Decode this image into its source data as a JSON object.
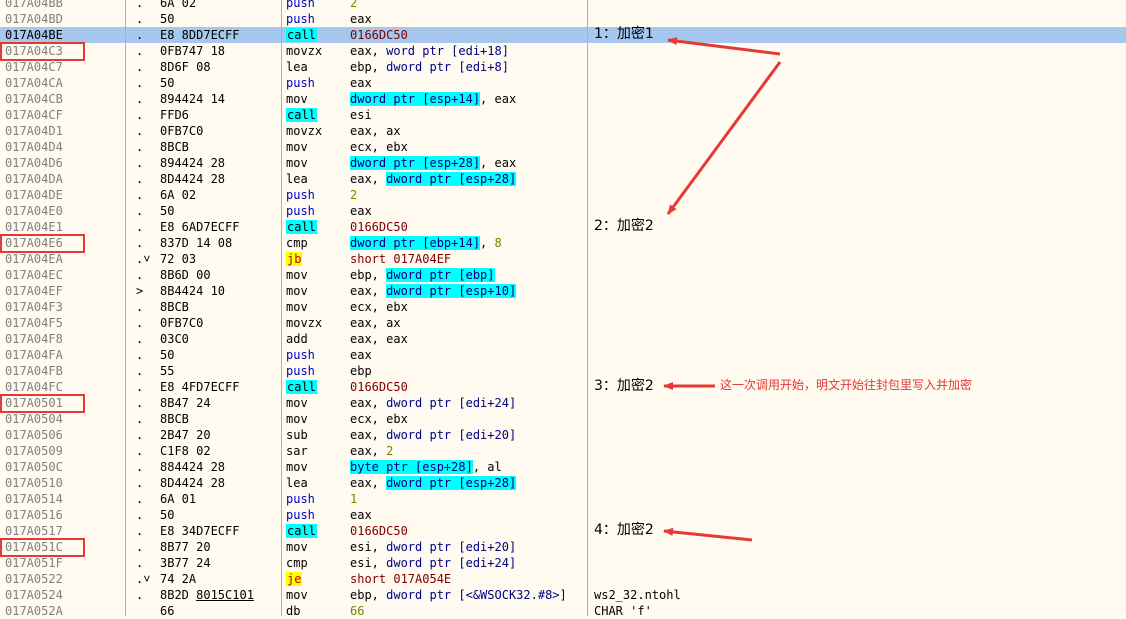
{
  "rows": [
    {
      "addr": "017A04BB",
      "mark": ".",
      "bytes": "6A 02",
      "mn": "push",
      "mk": "push",
      "ops": [
        {
          "t": "2",
          "k": "num"
        }
      ],
      "cmt": ""
    },
    {
      "addr": "017A04BD",
      "mark": ".",
      "bytes": "50",
      "mn": "push",
      "mk": "push",
      "ops": [
        {
          "t": "eax"
        }
      ],
      "cmt": ""
    },
    {
      "addr": "017A04BE",
      "mark": ".",
      "bytes": "E8 8DD7ECFF",
      "mn": "call",
      "mk": "call",
      "ops": [
        {
          "t": "0166DC50",
          "k": "tcall"
        }
      ],
      "cmt": "1：加密1",
      "selected": true
    },
    {
      "addr": "017A04C3",
      "mark": ".",
      "bytes": "0FB747 18",
      "mn": "movzx",
      "ops": [
        {
          "t": "eax, "
        },
        {
          "t": "word ptr [edi+18]",
          "k": "mem"
        }
      ],
      "cmt": "",
      "boxed": true
    },
    {
      "addr": "017A04C7",
      "mark": ".",
      "bytes": "8D6F 08",
      "mn": "lea",
      "ops": [
        {
          "t": "ebp, "
        },
        {
          "t": "dword ptr [edi+8]",
          "k": "mem"
        }
      ],
      "cmt": ""
    },
    {
      "addr": "017A04CA",
      "mark": ".",
      "bytes": "50",
      "mn": "push",
      "mk": "push",
      "ops": [
        {
          "t": "eax"
        }
      ],
      "cmt": ""
    },
    {
      "addr": "017A04CB",
      "mark": ".",
      "bytes": "894424 14",
      "mn": "mov",
      "ops": [
        {
          "t": "dword ptr [esp+14]",
          "k": "hlmem"
        },
        {
          "t": ", eax"
        }
      ],
      "cmt": ""
    },
    {
      "addr": "017A04CF",
      "mark": ".",
      "bytes": "FFD6",
      "mn": "call",
      "mk": "call",
      "ops": [
        {
          "t": "esi"
        }
      ],
      "cmt": ""
    },
    {
      "addr": "017A04D1",
      "mark": ".",
      "bytes": "0FB7C0",
      "mn": "movzx",
      "ops": [
        {
          "t": "eax, ax"
        }
      ],
      "cmt": ""
    },
    {
      "addr": "017A04D4",
      "mark": ".",
      "bytes": "8BCB",
      "mn": "mov",
      "ops": [
        {
          "t": "ecx, ebx"
        }
      ],
      "cmt": ""
    },
    {
      "addr": "017A04D6",
      "mark": ".",
      "bytes": "894424 28",
      "mn": "mov",
      "ops": [
        {
          "t": "dword ptr [esp+28]",
          "k": "hlmem"
        },
        {
          "t": ", eax"
        }
      ],
      "cmt": ""
    },
    {
      "addr": "017A04DA",
      "mark": ".",
      "bytes": "8D4424 28",
      "mn": "lea",
      "ops": [
        {
          "t": "eax, "
        },
        {
          "t": "dword ptr [esp+28]",
          "k": "hlmem"
        }
      ],
      "cmt": ""
    },
    {
      "addr": "017A04DE",
      "mark": ".",
      "bytes": "6A 02",
      "mn": "push",
      "mk": "push",
      "ops": [
        {
          "t": "2",
          "k": "num"
        }
      ],
      "cmt": ""
    },
    {
      "addr": "017A04E0",
      "mark": ".",
      "bytes": "50",
      "mn": "push",
      "mk": "push",
      "ops": [
        {
          "t": "eax"
        }
      ],
      "cmt": ""
    },
    {
      "addr": "017A04E1",
      "mark": ".",
      "bytes": "E8 6AD7ECFF",
      "mn": "call",
      "mk": "call",
      "ops": [
        {
          "t": "0166DC50",
          "k": "tcall"
        }
      ],
      "cmt": "2：加密2"
    },
    {
      "addr": "017A04E6",
      "mark": ".",
      "bytes": "837D 14 08",
      "mn": "cmp",
      "ops": [
        {
          "t": "dword ptr [ebp+14]",
          "k": "hlmem"
        },
        {
          "t": ", "
        },
        {
          "t": "8",
          "k": "num"
        }
      ],
      "cmt": "",
      "boxed": true
    },
    {
      "addr": "017A04EA",
      "mark": ".˅",
      "bytes": "72 03",
      "mn": "jb",
      "mk": "jmp",
      "ops": [
        {
          "t": "short 017A04EF",
          "k": "tjmp"
        }
      ],
      "cmt": ""
    },
    {
      "addr": "017A04EC",
      "mark": ".",
      "bytes": "8B6D 00",
      "mn": "mov",
      "ops": [
        {
          "t": "ebp, "
        },
        {
          "t": "dword ptr [ebp]",
          "k": "hlmem"
        }
      ],
      "cmt": ""
    },
    {
      "addr": "017A04EF",
      "mark": ">",
      "bytes": "8B4424 10",
      "mn": "mov",
      "ops": [
        {
          "t": "eax, "
        },
        {
          "t": "dword ptr [esp+10]",
          "k": "hlmem"
        }
      ],
      "cmt": ""
    },
    {
      "addr": "017A04F3",
      "mark": ".",
      "bytes": "8BCB",
      "mn": "mov",
      "ops": [
        {
          "t": "ecx, ebx"
        }
      ],
      "cmt": ""
    },
    {
      "addr": "017A04F5",
      "mark": ".",
      "bytes": "0FB7C0",
      "mn": "movzx",
      "ops": [
        {
          "t": "eax, ax"
        }
      ],
      "cmt": ""
    },
    {
      "addr": "017A04F8",
      "mark": ".",
      "bytes": "03C0",
      "mn": "add",
      "ops": [
        {
          "t": "eax, eax"
        }
      ],
      "cmt": ""
    },
    {
      "addr": "017A04FA",
      "mark": ".",
      "bytes": "50",
      "mn": "push",
      "mk": "push",
      "ops": [
        {
          "t": "eax"
        }
      ],
      "cmt": ""
    },
    {
      "addr": "017A04FB",
      "mark": ".",
      "bytes": "55",
      "mn": "push",
      "mk": "push",
      "ops": [
        {
          "t": "ebp"
        }
      ],
      "cmt": ""
    },
    {
      "addr": "017A04FC",
      "mark": ".",
      "bytes": "E8 4FD7ECFF",
      "mn": "call",
      "mk": "call",
      "ops": [
        {
          "t": "0166DC50",
          "k": "tcall"
        }
      ],
      "cmt": "3：加密2"
    },
    {
      "addr": "017A0501",
      "mark": ".",
      "bytes": "8B47 24",
      "mn": "mov",
      "ops": [
        {
          "t": "eax, "
        },
        {
          "t": "dword ptr [edi+24]",
          "k": "mem"
        }
      ],
      "cmt": "",
      "boxed": true
    },
    {
      "addr": "017A0504",
      "mark": ".",
      "bytes": "8BCB",
      "mn": "mov",
      "ops": [
        {
          "t": "ecx, ebx"
        }
      ],
      "cmt": ""
    },
    {
      "addr": "017A0506",
      "mark": ".",
      "bytes": "2B47 20",
      "mn": "sub",
      "ops": [
        {
          "t": "eax, "
        },
        {
          "t": "dword ptr [edi+20]",
          "k": "mem"
        }
      ],
      "cmt": ""
    },
    {
      "addr": "017A0509",
      "mark": ".",
      "bytes": "C1F8 02",
      "mn": "sar",
      "ops": [
        {
          "t": "eax, "
        },
        {
          "t": "2",
          "k": "num"
        }
      ],
      "cmt": ""
    },
    {
      "addr": "017A050C",
      "mark": ".",
      "bytes": "884424 28",
      "mn": "mov",
      "ops": [
        {
          "t": "byte ptr [esp+28]",
          "k": "hlmem"
        },
        {
          "t": ", al"
        }
      ],
      "cmt": ""
    },
    {
      "addr": "017A0510",
      "mark": ".",
      "bytes": "8D4424 28",
      "mn": "lea",
      "ops": [
        {
          "t": "eax, "
        },
        {
          "t": "dword ptr [esp+28]",
          "k": "hlmem"
        }
      ],
      "cmt": ""
    },
    {
      "addr": "017A0514",
      "mark": ".",
      "bytes": "6A 01",
      "mn": "push",
      "mk": "push",
      "ops": [
        {
          "t": "1",
          "k": "num"
        }
      ],
      "cmt": ""
    },
    {
      "addr": "017A0516",
      "mark": ".",
      "bytes": "50",
      "mn": "push",
      "mk": "push",
      "ops": [
        {
          "t": "eax"
        }
      ],
      "cmt": ""
    },
    {
      "addr": "017A0517",
      "mark": ".",
      "bytes": "E8 34D7ECFF",
      "mn": "call",
      "mk": "call",
      "ops": [
        {
          "t": "0166DC50",
          "k": "tcall"
        }
      ],
      "cmt": "4：加密2"
    },
    {
      "addr": "017A051C",
      "mark": ".",
      "bytes": "8B77 20",
      "mn": "mov",
      "ops": [
        {
          "t": "esi, "
        },
        {
          "t": "dword ptr [edi+20]",
          "k": "mem"
        }
      ],
      "cmt": "",
      "boxed": true
    },
    {
      "addr": "017A051F",
      "mark": ".",
      "bytes": "3B77 24",
      "mn": "cmp",
      "ops": [
        {
          "t": "esi, "
        },
        {
          "t": "dword ptr [edi+24]",
          "k": "mem"
        }
      ],
      "cmt": ""
    },
    {
      "addr": "017A0522",
      "mark": ".˅",
      "bytes": "74 2A",
      "mn": "je",
      "mk": "jmp",
      "ops": [
        {
          "t": "short 017A054E",
          "k": "tjmp"
        }
      ],
      "cmt": ""
    },
    {
      "addr": "017A0524",
      "mark": ".",
      "bytes": "8B2D 8015C101",
      "bytesU": "8015C101",
      "mn": "mov",
      "ops": [
        {
          "t": "ebp, "
        },
        {
          "t": "dword ptr [<&WSOCK32.#8>]",
          "k": "mem"
        }
      ],
      "cmt": "ws2_32.ntohl",
      "cmtMono": true
    },
    {
      "addr": "017A052A",
      "mark": "",
      "bytes": "66",
      "mn": "db",
      "ops": [
        {
          "t": "66",
          "k": "num"
        }
      ],
      "cmt": "CHAR 'f'",
      "cmtMono": true
    }
  ],
  "note": "这一次调用开始，明文开始往封包里写入并加密",
  "colors": {
    "annotation": "#e53935",
    "selection": "#a6c8ee",
    "call_highlight": "#00ffff",
    "jump_highlight": "#ffff00"
  }
}
